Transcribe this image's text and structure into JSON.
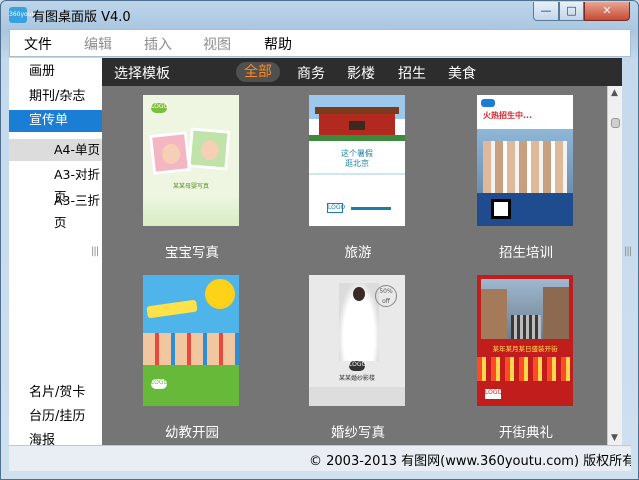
{
  "window": {
    "title": "有图桌面版 V4.0",
    "icon_label": "360youtu",
    "controls": {
      "minimize": "—",
      "maximize": "□",
      "close": "✕"
    }
  },
  "menu": [
    {
      "label": "文件",
      "enabled": true
    },
    {
      "label": "编辑",
      "enabled": false
    },
    {
      "label": "插入",
      "enabled": false
    },
    {
      "label": "视图",
      "enabled": false
    },
    {
      "label": "帮助",
      "enabled": true
    }
  ],
  "sidebar": {
    "categories_top": [
      {
        "label": "画册",
        "active": false
      },
      {
        "label": "期刊/杂志",
        "active": false
      },
      {
        "label": "宣传单",
        "active": true
      }
    ],
    "subitems": [
      {
        "label": "A4-单页",
        "active": true
      },
      {
        "label": "A3-对折页",
        "active": false
      },
      {
        "label": "A3-三折页",
        "active": false
      }
    ],
    "categories_bottom": [
      {
        "label": "名片/贺卡"
      },
      {
        "label": "台历/挂历"
      },
      {
        "label": "海报"
      }
    ]
  },
  "category_bar": {
    "title": "选择模板",
    "tabs": [
      {
        "label": "全部",
        "active": true
      },
      {
        "label": "商务",
        "active": false
      },
      {
        "label": "影楼",
        "active": false
      },
      {
        "label": "招生",
        "active": false
      },
      {
        "label": "美食",
        "active": false
      }
    ]
  },
  "templates": [
    {
      "label": "宝宝写真",
      "thumb_text": [
        "LOGO",
        "某某母婴写真"
      ]
    },
    {
      "label": "旅游",
      "thumb_text": [
        "这个暑假",
        "逛北京",
        "LOGO"
      ]
    },
    {
      "label": "招生培训",
      "thumb_text": [
        "火热招生中..."
      ]
    },
    {
      "label": "幼教开园",
      "thumb_text": [
        "LOGO"
      ]
    },
    {
      "label": "婚纱写真",
      "thumb_text": [
        "50% off",
        "LOGO",
        "某某婚纱影楼"
      ]
    },
    {
      "label": "开街典礼",
      "thumb_text": [
        "某年某月某日盛装开街",
        "LOGO"
      ]
    }
  ],
  "statusbar": {
    "copyright": "© 2003-2013 有图网(www.360youtu.com) 版权所有"
  },
  "colors": {
    "accent": "#1a7fd4",
    "tab_active": "#ff8a1c",
    "grid_bg": "#757575",
    "catbar_bg": "#2d2d2d"
  }
}
